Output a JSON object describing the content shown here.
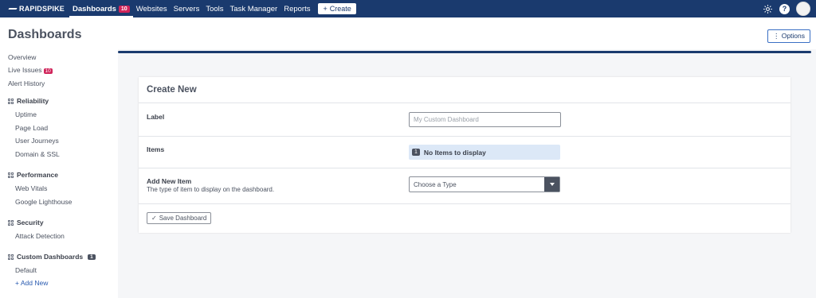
{
  "topnav": {
    "brand": "RAPIDSPIKE",
    "items": [
      {
        "label": "Dashboards",
        "badge": "10",
        "active": true
      },
      {
        "label": "Websites"
      },
      {
        "label": "Servers"
      },
      {
        "label": "Tools"
      },
      {
        "label": "Task Manager"
      },
      {
        "label": "Reports"
      }
    ],
    "create_label": "Create",
    "help_label": "?"
  },
  "page": {
    "title": "Dashboards",
    "options_label": "Options"
  },
  "sidebar": {
    "overview": "Overview",
    "live_issues": "Live Issues",
    "live_issues_badge": "10",
    "alert_history": "Alert History",
    "reliability": {
      "title": "Reliability",
      "items": [
        "Uptime",
        "Page Load",
        "User Journeys",
        "Domain & SSL"
      ]
    },
    "performance": {
      "title": "Performance",
      "items": [
        "Web Vitals",
        "Google Lighthouse"
      ]
    },
    "security": {
      "title": "Security",
      "items": [
        "Attack Detection"
      ]
    },
    "custom": {
      "title": "Custom Dashboards",
      "badge": "1",
      "items": [
        "Default"
      ],
      "add_new": "Add New"
    }
  },
  "form": {
    "title": "Create New",
    "label_field": {
      "label": "Label",
      "placeholder": "My Custom Dashboard",
      "value": ""
    },
    "items_field": {
      "label": "Items",
      "count": "1",
      "text": "No Items to display"
    },
    "add_item_field": {
      "label": "Add New Item",
      "help": "The type of item to display on the dashboard.",
      "select_value": "Choose a Type"
    },
    "save_label": "Save Dashboard"
  },
  "colors": {
    "nav_bg": "#1a3a6e",
    "badge_red": "#d0245a",
    "accent_blue": "#2a5bb0",
    "items_bg": "#dce8f7"
  }
}
